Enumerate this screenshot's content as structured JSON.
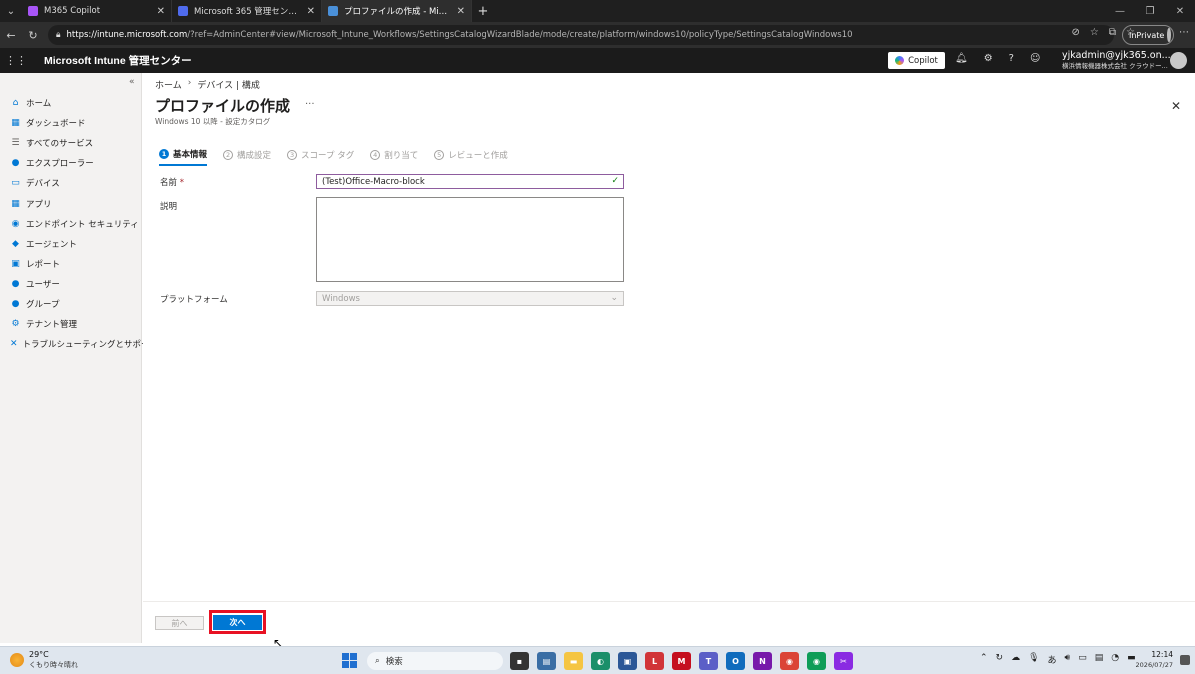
{
  "browser": {
    "tabs": [
      {
        "title": "M365 Copilot",
        "icon_color": "#a855f7",
        "active": false
      },
      {
        "title": "Microsoft 365 管理センター",
        "icon_color": "#4f6bed",
        "active": false
      },
      {
        "title": "プロファイルの作成 - Microsoft Intune",
        "icon_color": "#4a90d9",
        "active": true
      }
    ],
    "url_host": "https://intune.microsoft.com",
    "url_rest": "/?ref=AdminCenter#view/Microsoft_Intune_Workflows/SettingsCatalogWizardBlade/mode/create/platform/windows10/policyType/SettingsCatalogWindows10",
    "inprivate_label": "InPrivate"
  },
  "header": {
    "app_title": "Microsoft Intune 管理センター",
    "copilot_label": "Copilot",
    "user_name": "yjkadmin@yjk365.on...",
    "user_org": "横浜情報機器株式会社 クラウドー..."
  },
  "sidebar": {
    "items": [
      {
        "label": "ホーム",
        "icon": "home-icon",
        "glyph": "⌂",
        "color": "#0078d4"
      },
      {
        "label": "ダッシュボード",
        "icon": "dashboard-icon",
        "glyph": "▦",
        "color": "#0078d4"
      },
      {
        "label": "すべてのサービス",
        "icon": "list-icon",
        "glyph": "☰",
        "color": "#605e5c"
      },
      {
        "label": "エクスプローラー",
        "icon": "explorer-icon",
        "glyph": "●",
        "color": "#0078d4"
      },
      {
        "label": "デバイス",
        "icon": "devices-icon",
        "glyph": "▭",
        "color": "#0078d4"
      },
      {
        "label": "アプリ",
        "icon": "apps-icon",
        "glyph": "▦",
        "color": "#0078d4"
      },
      {
        "label": "エンドポイント セキュリティ",
        "icon": "endpoint-security-icon",
        "glyph": "◉",
        "color": "#0078d4"
      },
      {
        "label": "エージェント",
        "icon": "agents-icon",
        "glyph": "◆",
        "color": "#0078d4"
      },
      {
        "label": "レポート",
        "icon": "reports-icon",
        "glyph": "▣",
        "color": "#0078d4"
      },
      {
        "label": "ユーザー",
        "icon": "users-icon",
        "glyph": "●",
        "color": "#0078d4"
      },
      {
        "label": "グループ",
        "icon": "groups-icon",
        "glyph": "●",
        "color": "#0078d4"
      },
      {
        "label": "テナント管理",
        "icon": "tenant-admin-icon",
        "glyph": "⚙",
        "color": "#0078d4"
      },
      {
        "label": "トラブルシューティングとサポート",
        "icon": "troubleshooting-icon",
        "glyph": "✕",
        "color": "#0078d4"
      }
    ]
  },
  "main": {
    "breadcrumb": [
      "ホーム",
      "デバイス | 構成"
    ],
    "page_title": "プロファイルの作成",
    "subtitle": "Windows 10 以降 - 設定カタログ",
    "steps": [
      {
        "num": "1",
        "label": "基本情報",
        "active": true
      },
      {
        "num": "2",
        "label": "構成設定",
        "active": false
      },
      {
        "num": "3",
        "label": "スコープ タグ",
        "active": false
      },
      {
        "num": "4",
        "label": "割り当て",
        "active": false
      },
      {
        "num": "5",
        "label": "レビューと作成",
        "active": false
      }
    ],
    "form": {
      "name_label": "名前",
      "name_required": "*",
      "name_value": "(Test)Office-Macro-block",
      "description_label": "説明",
      "description_value": "",
      "platform_label": "プラットフォーム",
      "platform_value": "Windows"
    },
    "prev_label": "前へ",
    "next_label": "次へ"
  },
  "taskbar": {
    "temperature": "29°C",
    "weather_text": "くもり時々晴れ",
    "search_label": "検索",
    "time": "12:14",
    "date": "2026/07/27",
    "apps": [
      {
        "name": "taskview-icon",
        "color": "#333",
        "glyph": "▪"
      },
      {
        "name": "news-app-icon",
        "color": "#3a6ea5",
        "glyph": "▤"
      },
      {
        "name": "file-explorer-icon",
        "color": "#f5c542",
        "glyph": "▬"
      },
      {
        "name": "edge-icon",
        "color": "#1b8f6a",
        "glyph": "◐"
      },
      {
        "name": "store-icon",
        "color": "#2b5797",
        "glyph": "▣"
      },
      {
        "name": "l-app-icon",
        "color": "#d13438",
        "glyph": "L"
      },
      {
        "name": "mcafee-icon",
        "color": "#c50f1f",
        "glyph": "M"
      },
      {
        "name": "teams-icon",
        "color": "#5b5fc7",
        "glyph": "T"
      },
      {
        "name": "outlook-icon",
        "color": "#0f6cbd",
        "glyph": "O"
      },
      {
        "name": "onenote-icon",
        "color": "#7719aa",
        "glyph": "N"
      },
      {
        "name": "chrome-icon",
        "color": "#db4437",
        "glyph": "◉"
      },
      {
        "name": "chrome-alt-icon",
        "color": "#0f9d58",
        "glyph": "◉"
      },
      {
        "name": "snipping-tool-icon",
        "color": "#8a2be2",
        "glyph": "✂"
      }
    ]
  }
}
